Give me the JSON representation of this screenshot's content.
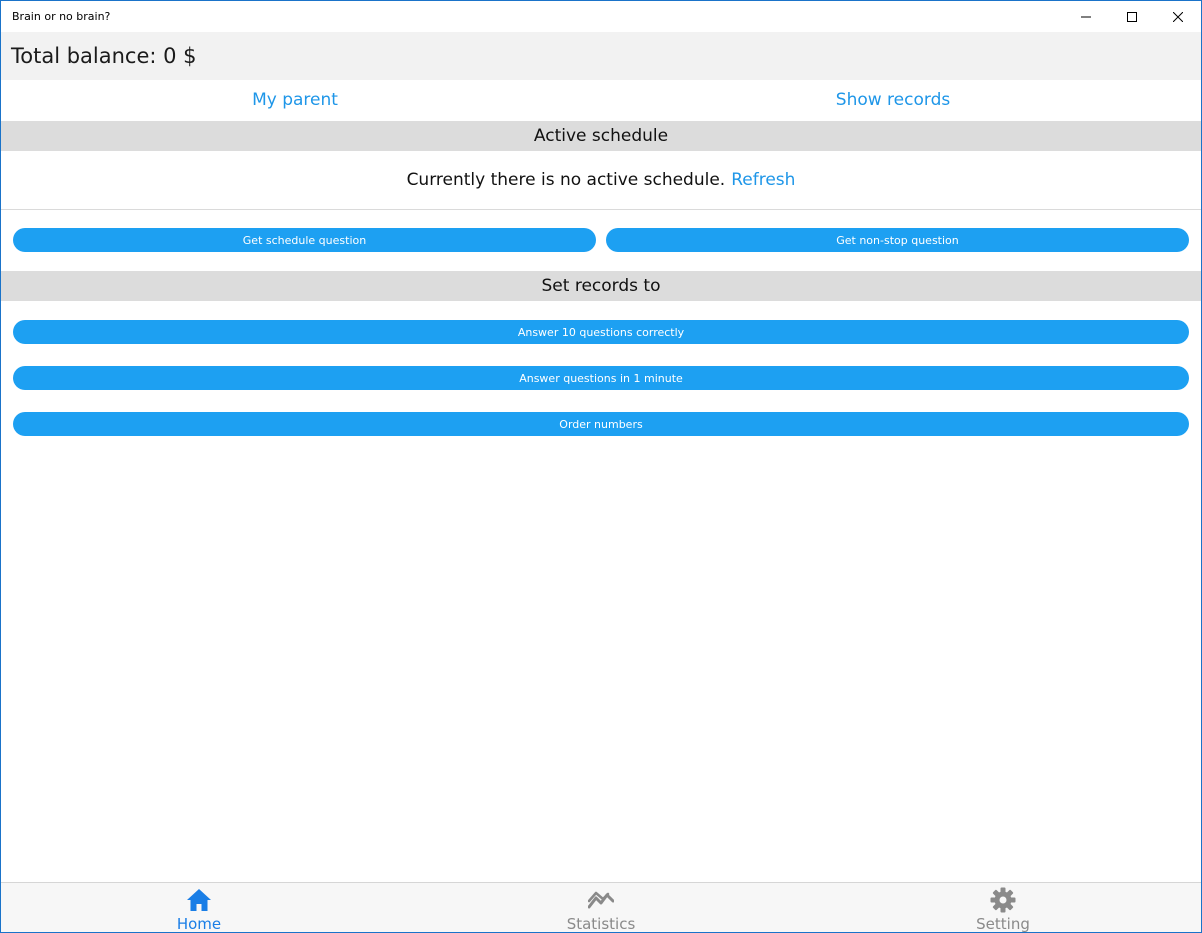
{
  "window": {
    "title": "Brain or no brain?"
  },
  "balance": {
    "text": "Total balance: 0 $"
  },
  "links": {
    "my_parent": "My parent",
    "show_records": "Show records"
  },
  "schedule": {
    "header": "Active schedule",
    "message": "Currently there is no active schedule.",
    "refresh": "Refresh"
  },
  "question_buttons": {
    "schedule": "Get schedule question",
    "non_stop": "Get non-stop question"
  },
  "records": {
    "header": "Set records to",
    "buttons": [
      "Answer 10 questions correctly",
      "Answer questions in 1 minute",
      "Order numbers"
    ]
  },
  "tabs": [
    {
      "label": "Home",
      "icon": "home-icon"
    },
    {
      "label": "Statistics",
      "icon": "statistics-icon"
    },
    {
      "label": "Setting",
      "icon": "gear-icon"
    }
  ],
  "colors": {
    "accent": "#1da0f2",
    "link": "#1e96e8",
    "active_tab": "#1a7ee6",
    "inactive_tab": "#8a8a8a"
  }
}
